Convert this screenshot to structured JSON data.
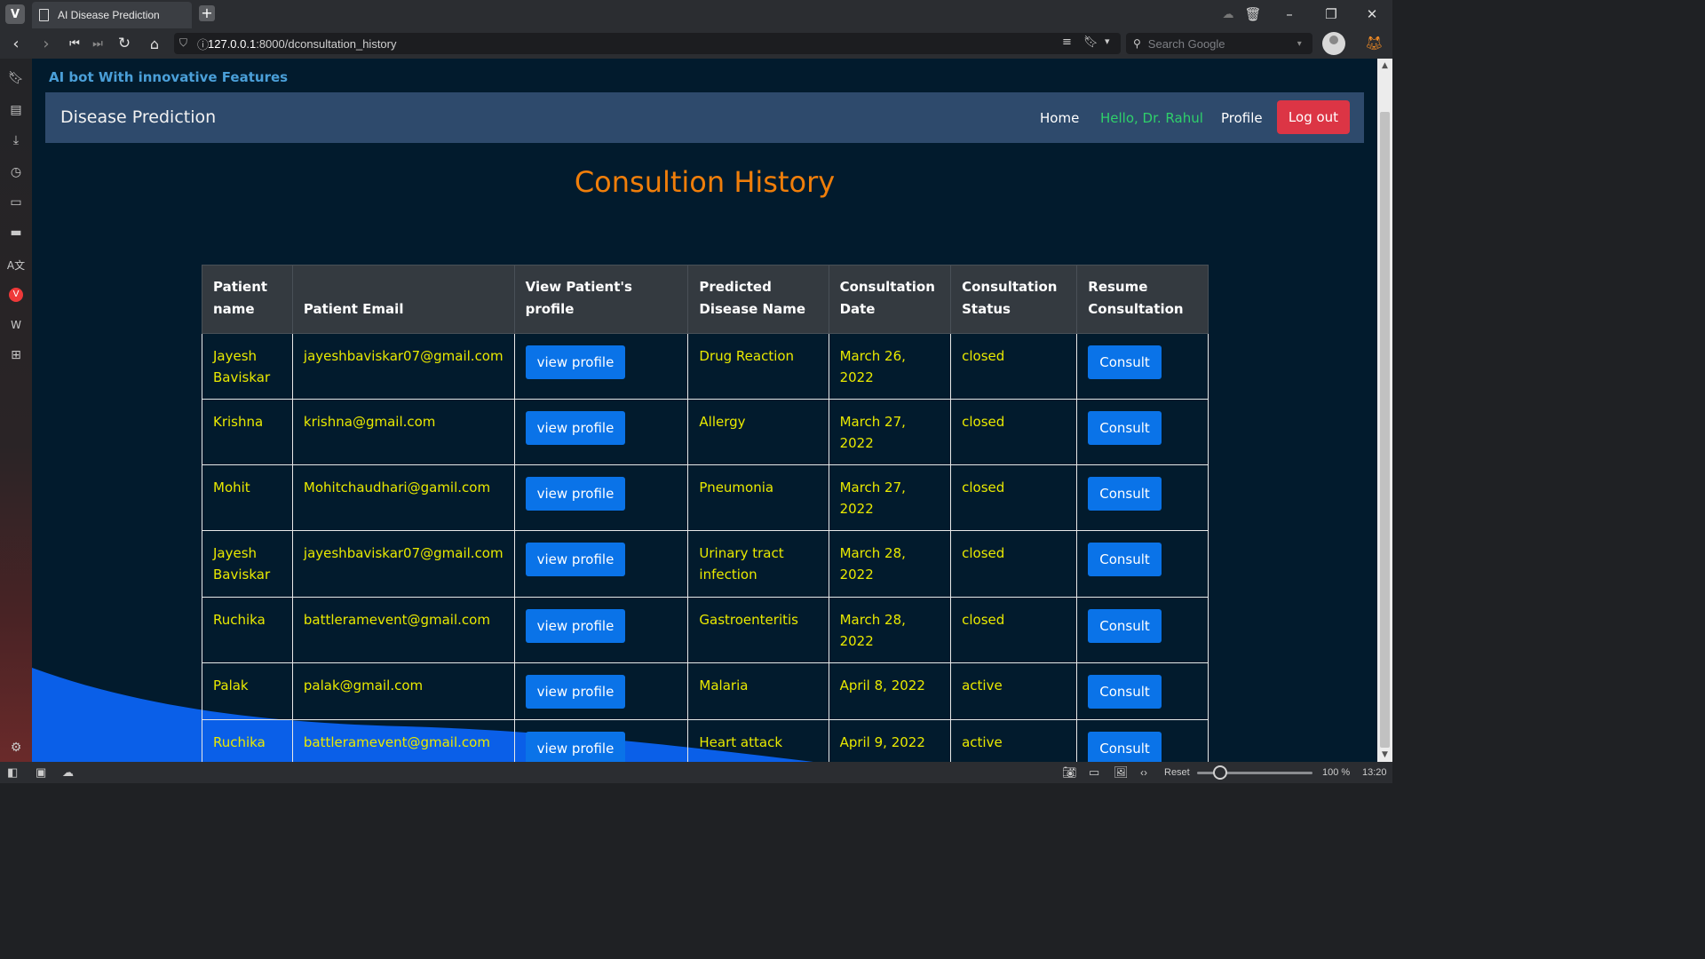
{
  "browser": {
    "tab_title": "AI Disease Prediction",
    "url_host": "127.0.0.1",
    "url_rest": ":8000/dconsultation_history",
    "search_placeholder": "Search Google",
    "zoom_reset_label": "Reset",
    "zoom_level": "100 %",
    "clock": "13:20"
  },
  "site": {
    "tagline": "AI bot With innovative Features",
    "brand": "Disease Prediction",
    "nav": {
      "home": "Home",
      "hello": "Hello, Dr. Rahul",
      "profile": "Profile",
      "logout": "Log out"
    },
    "heading": "Consultion History"
  },
  "table": {
    "headers": [
      "Patient name",
      "Patient Email",
      "View Patient's profile",
      "Predicted Disease Name",
      "Consultation Date",
      "Consultation Status",
      "Resume Consultation"
    ],
    "view_label": "view profile",
    "consult_label": "Consult",
    "rows": [
      {
        "name": "Jayesh Baviskar",
        "email": "jayeshbaviskar07@gmail.com",
        "disease": "Drug Reaction",
        "date": "March 26, 2022",
        "status": "closed"
      },
      {
        "name": "Krishna",
        "email": "krishna@gmail.com",
        "disease": "Allergy",
        "date": "March 27, 2022",
        "status": "closed"
      },
      {
        "name": "Mohit",
        "email": "Mohitchaudhari@gamil.com",
        "disease": "Pneumonia",
        "date": "March 27, 2022",
        "status": "closed"
      },
      {
        "name": "Jayesh Baviskar",
        "email": "jayeshbaviskar07@gmail.com",
        "disease": "Urinary tract infection",
        "date": "March 28, 2022",
        "status": "closed"
      },
      {
        "name": "Ruchika",
        "email": "battleramevent@gmail.com",
        "disease": "Gastroenteritis",
        "date": "March 28, 2022",
        "status": "closed"
      },
      {
        "name": "Palak",
        "email": "palak@gmail.com",
        "disease": "Malaria",
        "date": "April 8, 2022",
        "status": "active"
      },
      {
        "name": "Ruchika",
        "email": "battleramevent@gmail.com",
        "disease": "Heart attack",
        "date": "April 9, 2022",
        "status": "active"
      }
    ]
  },
  "colors": {
    "page_bg": "#021b2d",
    "navbar_bg": "#2e4a6c",
    "heading": "#f07e0a",
    "cell_text": "#e9e900",
    "hello_text": "#2fd06a",
    "logout_bg": "#dc3545",
    "button_blue": "#0a73e8",
    "wave": "#0a5fe8"
  }
}
